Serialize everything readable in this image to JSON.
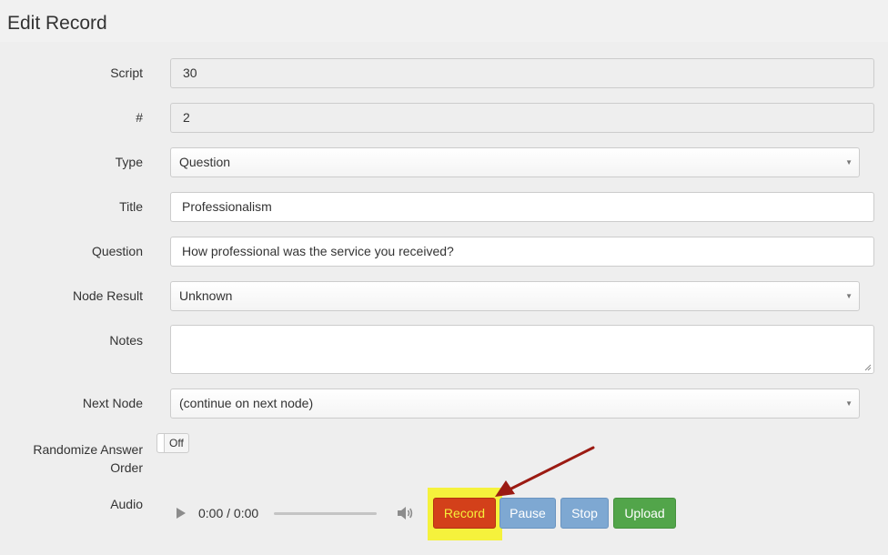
{
  "page": {
    "title": "Edit Record"
  },
  "form": {
    "script": {
      "label": "Script",
      "value": "30"
    },
    "number": {
      "label": "#",
      "value": "2"
    },
    "type": {
      "label": "Type",
      "value": "Question"
    },
    "title": {
      "label": "Title",
      "value": "Professionalism"
    },
    "question": {
      "label": "Question",
      "value": "How professional was the service you received?"
    },
    "node_result": {
      "label": "Node Result",
      "value": "Unknown"
    },
    "notes": {
      "label": "Notes",
      "value": ""
    },
    "next_node": {
      "label": "Next Node",
      "value": "(continue on next node)"
    },
    "randomize": {
      "label_line1": "Randomize Answer",
      "label_line2": "Order",
      "toggle_text": "Off"
    },
    "audio": {
      "label": "Audio",
      "time": "0:00 / 0:00",
      "record_label": "Record",
      "pause_label": "Pause",
      "stop_label": "Stop",
      "upload_label": "Upload"
    }
  },
  "colors": {
    "record": "#d3401a",
    "pause_stop": "#7ea8d2",
    "upload": "#52a54a",
    "highlight": "#f5f23c",
    "annotation_arrow": "#9b1a12"
  }
}
